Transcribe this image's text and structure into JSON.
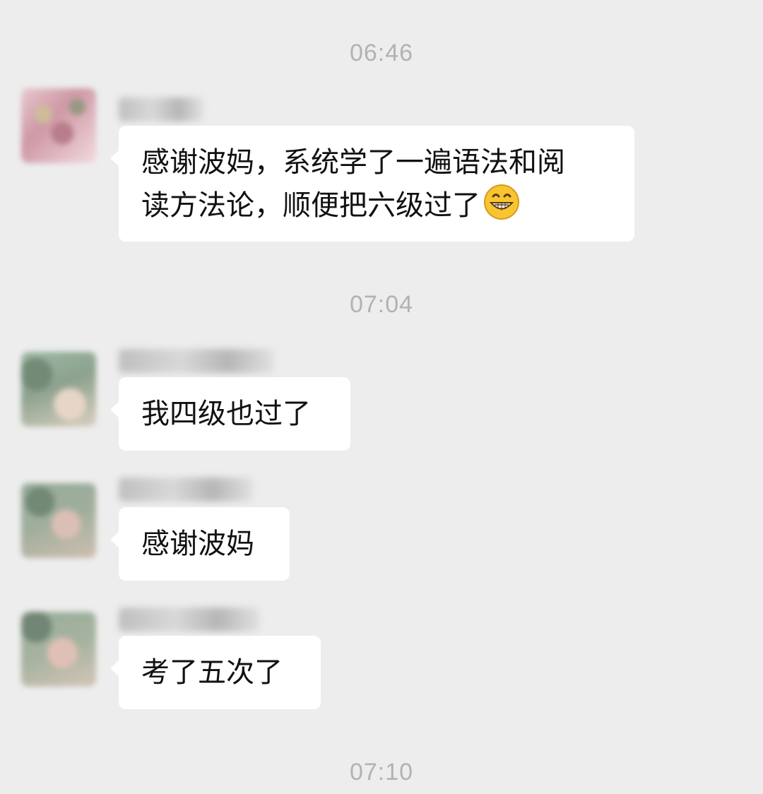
{
  "timestamps": [
    "06:46",
    "07:04",
    "07:10"
  ],
  "messages": [
    {
      "text_line1": "感谢波妈，系统学了一遍语法和阅",
      "text_line2": "读方法论，顺便把六级过了",
      "emoji": "grinning-face-icon"
    },
    {
      "text": "我四级也过了"
    },
    {
      "text": "感谢波妈"
    },
    {
      "text": "考了五次了"
    }
  ],
  "colors": {
    "background": "#ededed",
    "bubble": "#ffffff",
    "timestamp": "#b2b2b2",
    "message_text": "#111111"
  }
}
